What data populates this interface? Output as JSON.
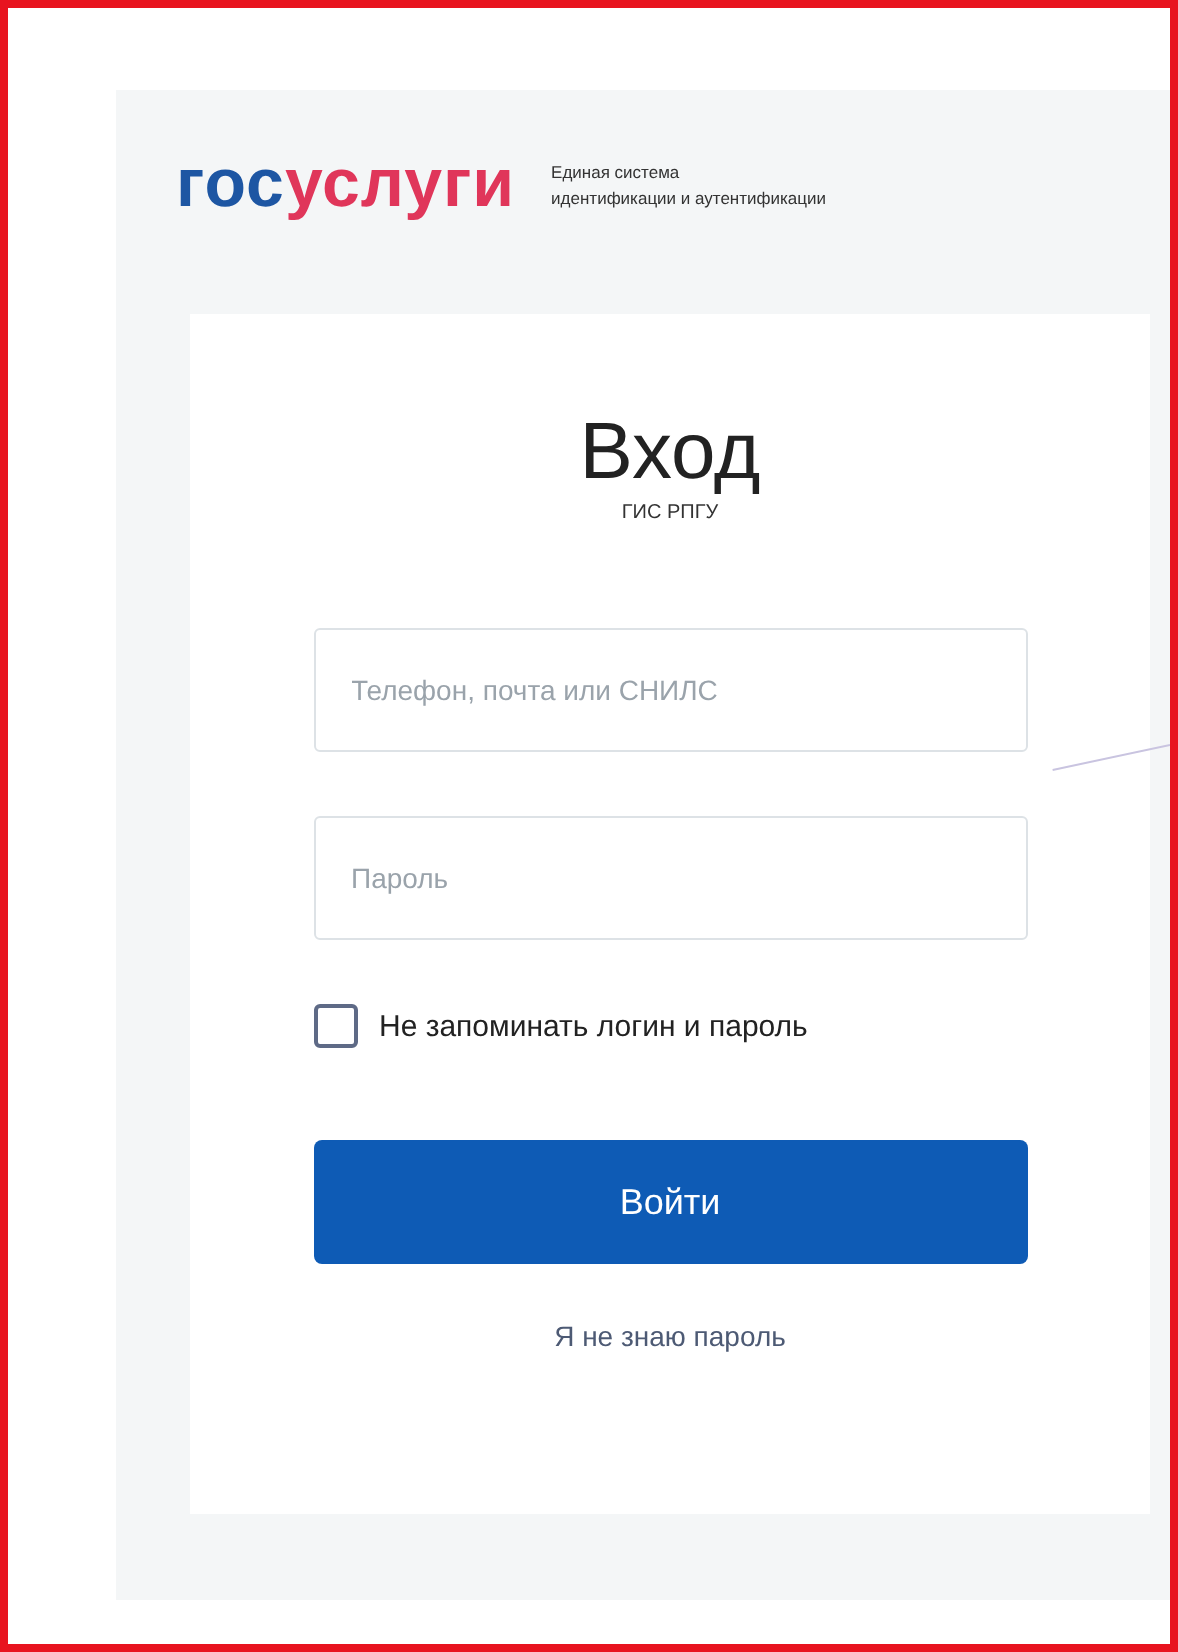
{
  "logo": [
    {
      "text": "гос",
      "color": "#1d56a3"
    },
    {
      "text": "услуги",
      "color": "#e0365a"
    }
  ],
  "tagline": [
    "Единая система",
    "идентификации и аутентификации"
  ],
  "form": {
    "title": "Вход",
    "subtitle": "ГИС РПГУ",
    "fields": [
      {
        "placeholder": "Телефон, почта или СНИЛС"
      },
      {
        "placeholder": "Пароль"
      }
    ],
    "checkbox": {
      "label": "Не запоминать логин и пароль",
      "checked": false
    },
    "submit": "Войти",
    "link": "Я не знаю пароль"
  }
}
